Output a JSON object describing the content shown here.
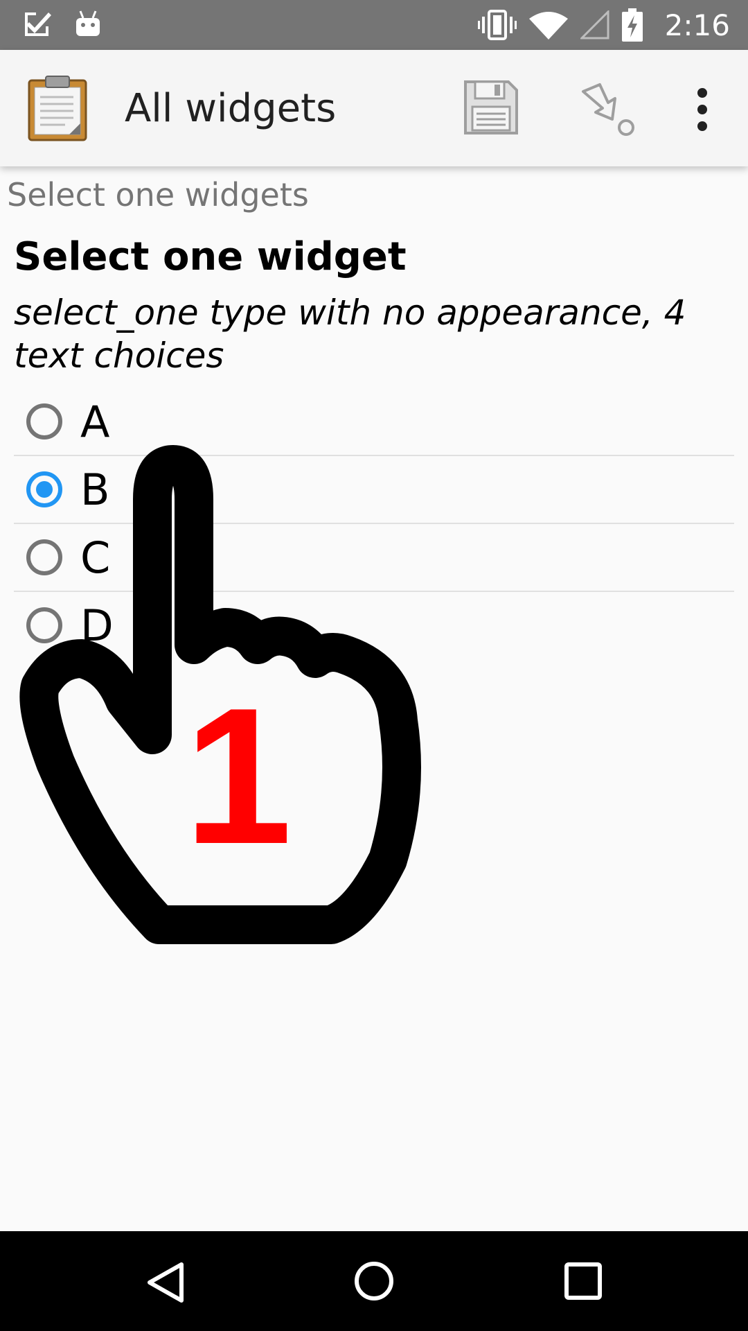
{
  "status_bar": {
    "time": "2:16",
    "icons": [
      "tasks-check-icon",
      "android-icon",
      "vibrate-icon",
      "wifi-icon",
      "signal-icon",
      "battery-charging-icon"
    ]
  },
  "app_bar": {
    "title": "All widgets",
    "actions": [
      "save-icon",
      "jump-to-icon",
      "overflow-menu-icon"
    ]
  },
  "form": {
    "group_label": "Select one widgets",
    "question_title": "Select one widget",
    "question_hint": "select_one type with no appearance, 4 text choices",
    "choices": [
      {
        "label": "A",
        "selected": false
      },
      {
        "label": "B",
        "selected": true
      },
      {
        "label": "C",
        "selected": false
      },
      {
        "label": "D",
        "selected": false
      }
    ]
  },
  "overlay": {
    "icon": "pointing-hand-icon",
    "step_number": "1",
    "step_color": "#ff0000"
  },
  "nav_bar": {
    "buttons": [
      "back-icon",
      "home-icon",
      "recents-icon"
    ]
  },
  "colors": {
    "accent": "#2196f3",
    "status_bar": "#757575",
    "app_bar": "#f5f5f5"
  }
}
